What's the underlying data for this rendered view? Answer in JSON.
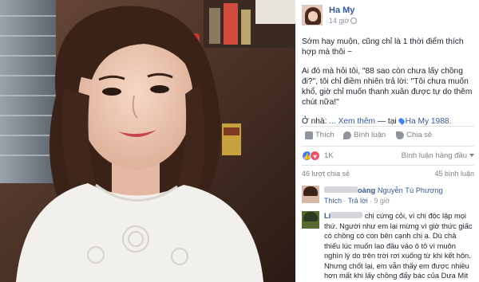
{
  "post": {
    "author": "Ha My",
    "time": "14 giờ",
    "paragraphs": [
      "Sớm hay muộn, cũng chỉ là 1 thời điểm thích hợp mà thôi ~",
      "Ai đó mà hỏi tôi, \"88 sao còn chưa lấy chồng đi?\", tôi chỉ điềm nhiên trả lời: \"Tôi chưa muốn khổ, giờ chỉ muốn thanh xuân được tự do thêm chút nữa!\""
    ],
    "location_prefix": "Ở nhà:",
    "see_more": "... Xem thêm",
    "at_label": "— tại",
    "place": "Ha My 1988."
  },
  "actions": {
    "like": "Thích",
    "comment": "Bình luận",
    "share": "Chia sẻ"
  },
  "reactions": {
    "count": "1K",
    "ranking": "Bình luận hàng đầu"
  },
  "stats": {
    "shares": "46 lượt chia sẻ",
    "comments": "45 bình luận"
  },
  "comments": [
    {
      "name_visible": "oàng",
      "name": "Nguyễn Tú Phương",
      "like": "Thích",
      "reply": "Trả lời",
      "time": "9 giờ"
    },
    {
      "name_visible": "Li",
      "text": "chị cứng cỏi, vì chị độc lập mọi thứ. Người như em lại mừng vì giờ thức giấc có chồng có con bên cạnh chị ạ. Dù chả thiếu lúc muốn lao đầu vào ô tô vì muôn nghìn lý do trên trời rơi xuống từ khi kết hôn. Nhưng chốt lại, em vẫn thấy em được nhiều hơn mất khi lấy chồng đấy bác của Dưa Mít ạ"
    }
  ],
  "colors": {
    "link": "#365899",
    "like_reaction": "#4080ff",
    "love_reaction": "#f25268"
  }
}
